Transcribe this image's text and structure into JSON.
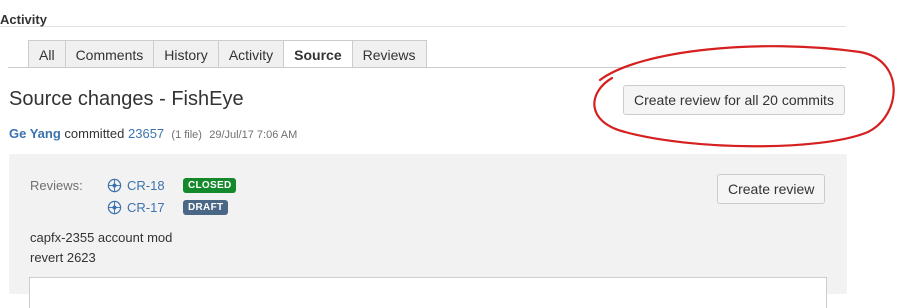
{
  "section": {
    "title": "Activity"
  },
  "tabs": [
    "All",
    "Comments",
    "History",
    "Activity",
    "Source",
    "Reviews"
  ],
  "active_tab": "Source",
  "heading": "Source changes - FishEye",
  "create_all_button": "Create review for all 20 commits",
  "commit": {
    "author": "Ge Yang",
    "verb": "committed",
    "revision": "23657",
    "files": "(1 file)",
    "date": "29/Jul/17 7:06 AM"
  },
  "reviews_label": "Reviews:",
  "reviews": [
    {
      "key": "CR-18",
      "status": "CLOSED",
      "status_color": "#14892c"
    },
    {
      "key": "CR-17",
      "status": "DRAFT",
      "status_color": "#4a6785"
    }
  ],
  "create_review_button": "Create review",
  "commit_message": [
    "capfx-2355 account mod",
    "revert 2623"
  ],
  "colors": {
    "link": "#3b73af",
    "annotation": "#d62020"
  }
}
